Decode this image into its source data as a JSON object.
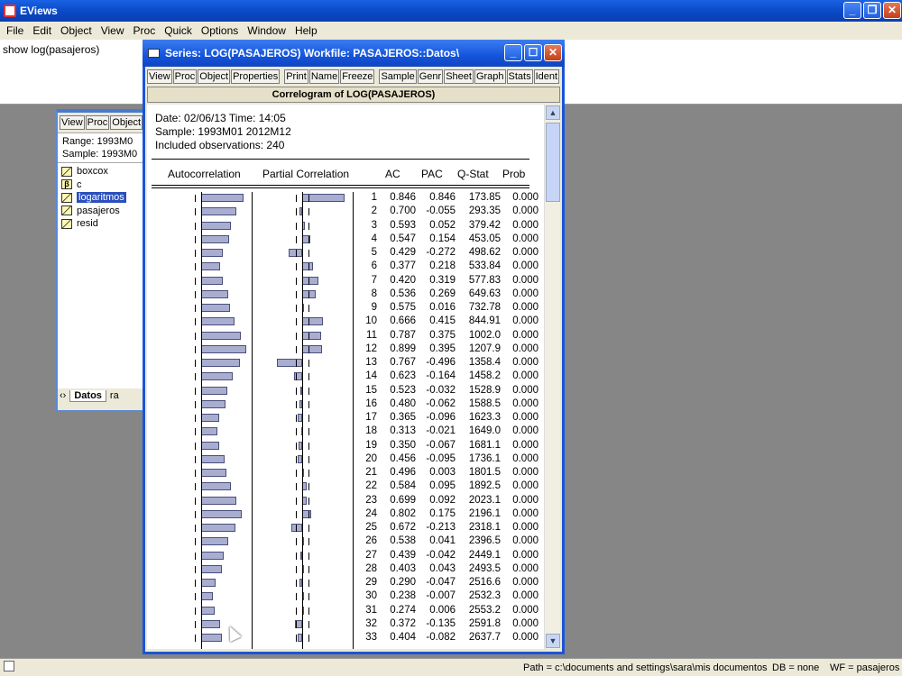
{
  "app": {
    "title": "EViews",
    "menu": [
      "File",
      "Edit",
      "Object",
      "View",
      "Proc",
      "Quick",
      "Options",
      "Window",
      "Help"
    ],
    "command": "show log(pasajeros)"
  },
  "workfile": {
    "buttons": [
      "View",
      "Proc",
      "Object"
    ],
    "range": "Range:  1993M0",
    "sample": "Sample: 1993M0",
    "items": [
      {
        "name": "boxcox",
        "icon": "series-icon",
        "glyph": ""
      },
      {
        "name": "c",
        "icon": "coef-icon",
        "glyph": "β"
      },
      {
        "name": "logaritmos",
        "icon": "series-icon",
        "glyph": ""
      },
      {
        "name": "pasajeros",
        "icon": "series-icon",
        "glyph": ""
      },
      {
        "name": "resid",
        "icon": "series-icon",
        "glyph": ""
      }
    ],
    "tabs": [
      "Datos",
      "ra"
    ]
  },
  "series": {
    "title": "Series: LOG(PASAJEROS)   Workfile: PASAJEROS::Datos\\",
    "buttons": [
      "View",
      "Proc",
      "Object",
      "Properties",
      "Print",
      "Name",
      "Freeze",
      "Sample",
      "Genr",
      "Sheet",
      "Graph",
      "Stats",
      "Ident"
    ],
    "header": "Correlogram of LOG(PASAJEROS)",
    "date": "Date: 02/06/13   Time: 14:05",
    "sample": "Sample: 1993M01 2012M12",
    "obs": "Included observations: 240",
    "col_ac_graph": "Autocorrelation",
    "col_pac_graph": "Partial Correlation",
    "col_ac": "AC",
    "col_pac": "PAC",
    "col_q": "Q-Stat",
    "col_prob": "Prob"
  },
  "chart_data": {
    "type": "table",
    "rows": [
      [
        "1",
        "0.846",
        "0.846",
        "173.85",
        "0.000"
      ],
      [
        "2",
        "0.700",
        "-0.055",
        "293.35",
        "0.000"
      ],
      [
        "3",
        "0.593",
        "0.052",
        "379.42",
        "0.000"
      ],
      [
        "4",
        "0.547",
        "0.154",
        "453.05",
        "0.000"
      ],
      [
        "5",
        "0.429",
        "-0.272",
        "498.62",
        "0.000"
      ],
      [
        "6",
        "0.377",
        "0.218",
        "533.84",
        "0.000"
      ],
      [
        "7",
        "0.420",
        "0.319",
        "577.83",
        "0.000"
      ],
      [
        "8",
        "0.536",
        "0.269",
        "649.63",
        "0.000"
      ],
      [
        "9",
        "0.575",
        "0.016",
        "732.78",
        "0.000"
      ],
      [
        "10",
        "0.666",
        "0.415",
        "844.91",
        "0.000"
      ],
      [
        "11",
        "0.787",
        "0.375",
        "1002.0",
        "0.000"
      ],
      [
        "12",
        "0.899",
        "0.395",
        "1207.9",
        "0.000"
      ],
      [
        "13",
        "0.767",
        "-0.496",
        "1358.4",
        "0.000"
      ],
      [
        "14",
        "0.623",
        "-0.164",
        "1458.2",
        "0.000"
      ],
      [
        "15",
        "0.523",
        "-0.032",
        "1528.9",
        "0.000"
      ],
      [
        "16",
        "0.480",
        "-0.062",
        "1588.5",
        "0.000"
      ],
      [
        "17",
        "0.365",
        "-0.096",
        "1623.3",
        "0.000"
      ],
      [
        "18",
        "0.313",
        "-0.021",
        "1649.0",
        "0.000"
      ],
      [
        "19",
        "0.350",
        "-0.067",
        "1681.1",
        "0.000"
      ],
      [
        "20",
        "0.456",
        "-0.095",
        "1736.1",
        "0.000"
      ],
      [
        "21",
        "0.496",
        "0.003",
        "1801.5",
        "0.000"
      ],
      [
        "22",
        "0.584",
        "0.095",
        "1892.5",
        "0.000"
      ],
      [
        "23",
        "0.699",
        "0.092",
        "2023.1",
        "0.000"
      ],
      [
        "24",
        "0.802",
        "0.175",
        "2196.1",
        "0.000"
      ],
      [
        "25",
        "0.672",
        "-0.213",
        "2318.1",
        "0.000"
      ],
      [
        "26",
        "0.538",
        "0.041",
        "2396.5",
        "0.000"
      ],
      [
        "27",
        "0.439",
        "-0.042",
        "2449.1",
        "0.000"
      ],
      [
        "28",
        "0.403",
        "0.043",
        "2493.5",
        "0.000"
      ],
      [
        "29",
        "0.290",
        "-0.047",
        "2516.6",
        "0.000"
      ],
      [
        "30",
        "0.238",
        "-0.007",
        "2532.3",
        "0.000"
      ],
      [
        "31",
        "0.274",
        "0.006",
        "2553.2",
        "0.000"
      ],
      [
        "32",
        "0.372",
        "-0.135",
        "2591.8",
        "0.000"
      ],
      [
        "33",
        "0.404",
        "-0.082",
        "2637.7",
        "0.000"
      ]
    ]
  },
  "status": {
    "path": "Path = c:\\documents and settings\\sara\\mis documentos",
    "db": "DB = none",
    "wf": "WF = pasajeros"
  }
}
